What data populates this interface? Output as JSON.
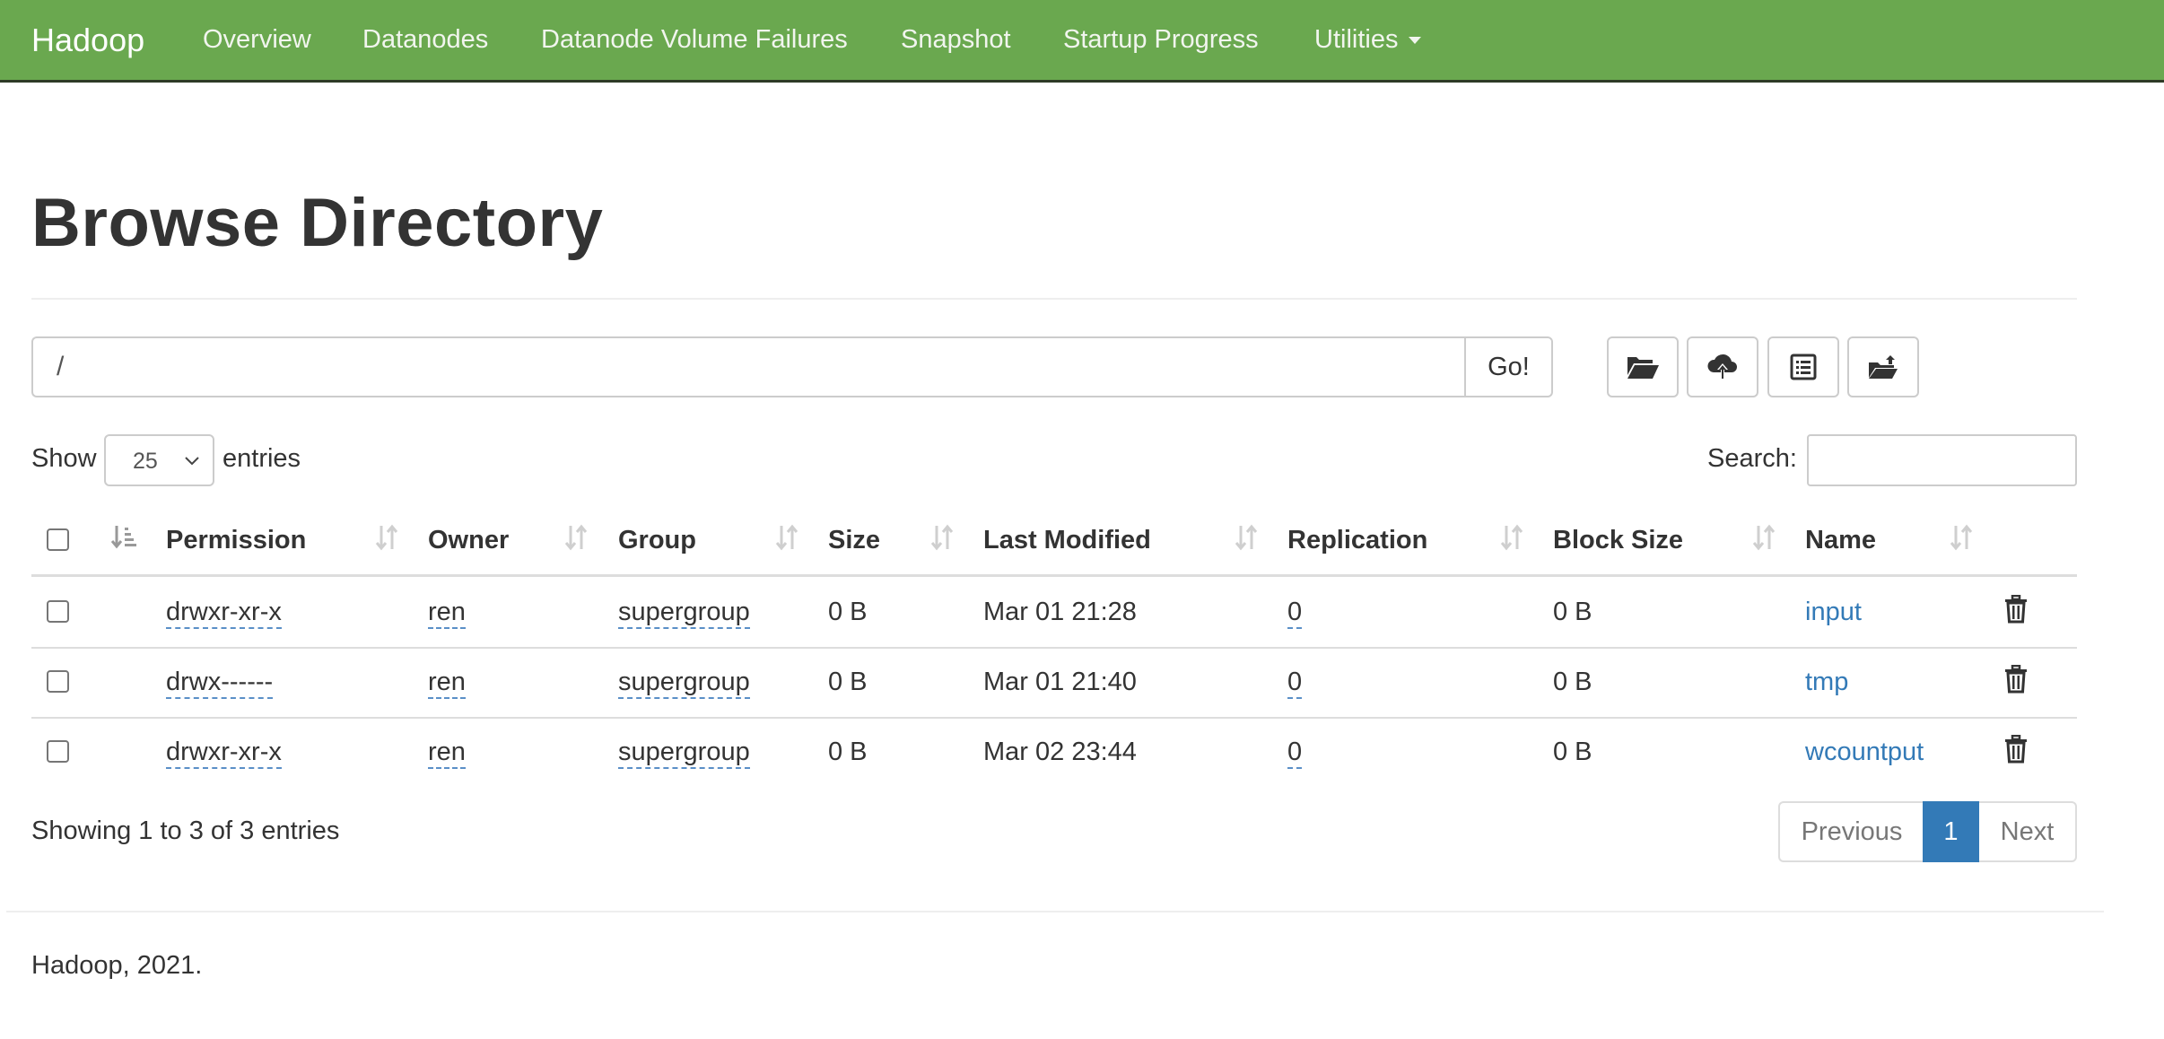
{
  "navbar": {
    "brand": "Hadoop",
    "items": [
      "Overview",
      "Datanodes",
      "Datanode Volume Failures",
      "Snapshot",
      "Startup Progress",
      "Utilities"
    ]
  },
  "page": {
    "title": "Browse Directory"
  },
  "pathbar": {
    "path_value": "/",
    "go_label": "Go!",
    "tool_icons": [
      "folder-open-icon",
      "cloud-upload-icon",
      "list-alt-icon",
      "folder-move-icon"
    ]
  },
  "table_controls": {
    "show_label": "Show",
    "page_length": "25",
    "entries_label": "entries",
    "search_label": "Search:",
    "search_value": ""
  },
  "table": {
    "columns": [
      "Permission",
      "Owner",
      "Group",
      "Size",
      "Last Modified",
      "Replication",
      "Block Size",
      "Name"
    ],
    "rows": [
      {
        "permission": "drwxr-xr-x",
        "owner": "ren",
        "group": "supergroup",
        "size": "0 B",
        "modified": "Mar 01 21:28",
        "replication": "0",
        "block_size": "0 B",
        "name": "input"
      },
      {
        "permission": "drwx------",
        "owner": "ren",
        "group": "supergroup",
        "size": "0 B",
        "modified": "Mar 01 21:40",
        "replication": "0",
        "block_size": "0 B",
        "name": "tmp"
      },
      {
        "permission": "drwxr-xr-x",
        "owner": "ren",
        "group": "supergroup",
        "size": "0 B",
        "modified": "Mar 02 23:44",
        "replication": "0",
        "block_size": "0 B",
        "name": "wcountput"
      }
    ]
  },
  "info": {
    "summary": "Showing 1 to 3 of 3 entries"
  },
  "pagination": {
    "previous": "Previous",
    "current": "1",
    "next": "Next"
  },
  "footer": {
    "text": "Hadoop, 2021."
  },
  "colors": {
    "navbar_bg": "#6aa84f",
    "link": "#337ab7",
    "active_page": "#337ab7"
  }
}
